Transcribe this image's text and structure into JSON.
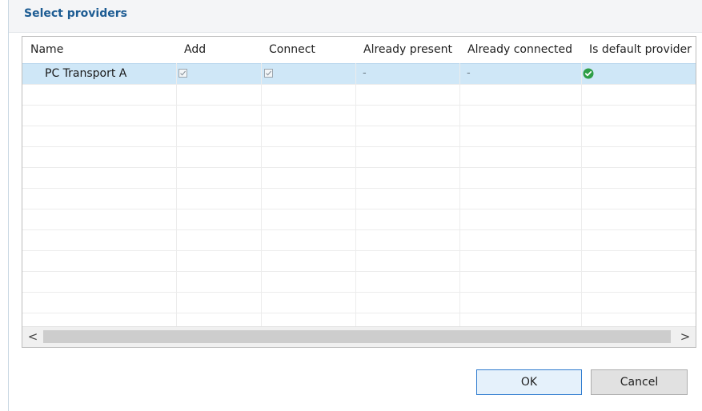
{
  "dialog": {
    "title": "Select providers"
  },
  "table": {
    "columns": [
      "Name",
      "Add",
      "Connect",
      "Already present",
      "Already connected",
      "Is default provider"
    ],
    "rows": [
      {
        "name": "PC Transport A",
        "add_checked": true,
        "connect_checked": true,
        "already_present": "-",
        "already_connected": "-",
        "is_default_icon": "green-check-circle-icon"
      }
    ]
  },
  "scrollbar": {
    "left_arrow": "<",
    "right_arrow": ">"
  },
  "buttons": {
    "ok": "OK",
    "cancel": "Cancel"
  },
  "colors": {
    "title": "#1d5c93",
    "selected_row": "#cfe7f7",
    "default_provider_icon": "#2e9e46",
    "ok_border": "#2e7bcf"
  }
}
